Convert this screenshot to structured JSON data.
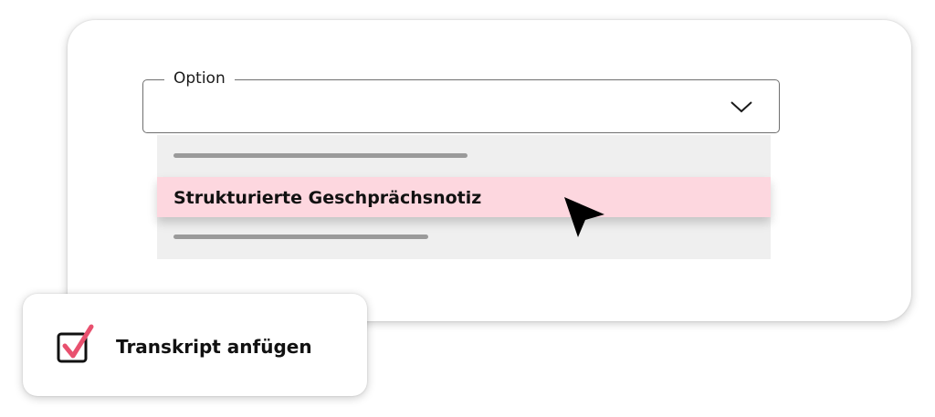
{
  "select": {
    "label": "Option",
    "value": "",
    "icon": "chevron-down-icon"
  },
  "dropdown": {
    "highlighted_option": "Strukturierte Geschprächsnotiz",
    "highlight_color": "#fdd7df"
  },
  "checkbox": {
    "label": "Transkript anfügen",
    "checked": true,
    "check_color": "#e8506e"
  },
  "cursor": {
    "icon": "mouse-pointer-icon"
  }
}
